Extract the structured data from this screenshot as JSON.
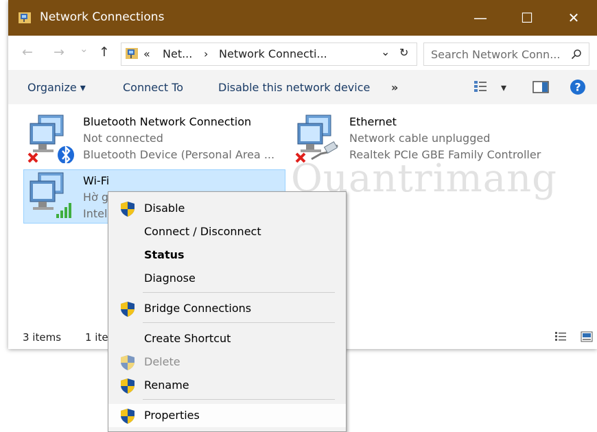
{
  "window": {
    "title": "Network Connections",
    "controls": {
      "minimize": "—",
      "maximize": "☐",
      "close": "✕"
    }
  },
  "address": {
    "nav": {
      "back": "←",
      "forward": "→",
      "recent": "⌄",
      "up": "↑"
    },
    "prefix": "«",
    "crumb1": "Net...",
    "sep": "›",
    "crumb2": "Network Connecti...",
    "dropdown": "⌄",
    "refresh": "↻",
    "search_placeholder": "Search Network Conn..."
  },
  "toolbar": {
    "organize": "Organize",
    "connect_to": "Connect To",
    "disable_device": "Disable this network device",
    "more": "»",
    "arrow": "▾"
  },
  "connections": [
    {
      "name": "Bluetooth Network Connection",
      "status": "Not connected",
      "device": "Bluetooth Device (Personal Area ...",
      "icon": "bluetooth-network-icon",
      "error": true
    },
    {
      "name": "Ethernet",
      "status": "Network cable unplugged",
      "device": "Realtek PCIe GBE Family Controller",
      "icon": "ethernet-network-icon",
      "error": true
    },
    {
      "name": "Wi-Fi",
      "status": "Hờ g",
      "device": "Intel",
      "icon": "wifi-network-icon",
      "error": false
    }
  ],
  "watermark": "Quantrimang",
  "statusbar": {
    "items": "3 items",
    "selected": "1 ite"
  },
  "context_menu": [
    {
      "label": "Disable",
      "shield": true,
      "bold": false,
      "disabled": false
    },
    {
      "label": "Connect / Disconnect",
      "shield": false,
      "bold": false,
      "disabled": false
    },
    {
      "label": "Status",
      "shield": false,
      "bold": true,
      "disabled": false
    },
    {
      "label": "Diagnose",
      "shield": false,
      "bold": false,
      "disabled": false
    },
    {
      "label": "Bridge Connections",
      "shield": true,
      "bold": false,
      "disabled": false
    },
    {
      "label": "Create Shortcut",
      "shield": false,
      "bold": false,
      "disabled": false
    },
    {
      "label": "Delete",
      "shield": true,
      "bold": false,
      "disabled": true
    },
    {
      "label": "Rename",
      "shield": true,
      "bold": false,
      "disabled": false
    },
    {
      "label": "Properties",
      "shield": true,
      "bold": false,
      "disabled": false
    }
  ],
  "colors": {
    "titlebar": "#7a4d11",
    "selection": "#cce8ff",
    "menu_bg": "#f2f2f2",
    "link": "#1a3b66"
  }
}
